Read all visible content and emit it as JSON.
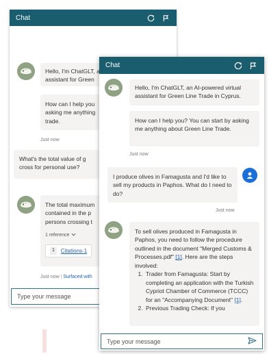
{
  "back_panel": {
    "title": "Chat",
    "greeting_line1": "Hello, I'm ChatGLT, an AI-powered virtual",
    "greeting_line2": "assistant for Green",
    "help_line1": "How can I help you",
    "help_line2": "asking me anything",
    "help_line3": "trade.",
    "time1": "Just now",
    "question_line1": "What's the total value of g",
    "question_line2": "cross for personal use?",
    "answer_line1": "The total maximum",
    "answer_line2": "contained in the p",
    "answer_line3": "persons crossing t",
    "reference_label": "1 reference",
    "citation_num": "1",
    "citation_label": "Citations-1",
    "time2": "Just now",
    "surfaced_label": "Surfaced with",
    "input_placeholder": "Type your message"
  },
  "front_panel": {
    "title": "Chat",
    "greeting": "Hello, I'm ChatGLT, an AI-powered virtual assistant for Green Line Trade in Cyprus.",
    "help": "How can I help you? You can start by asking me anything about Green Line Trade.",
    "time1": "Just now",
    "user_message": "I produce olives in Famagusta and I'd like to sell my products in Paphos. What do I need to do?",
    "time2": "Just now",
    "answer_intro_a": "To sell olives produced in Famagusta in Paphos, you need to follow the procedure outlined in the document \"Merged Customs & Processes.pdf\" ",
    "answer_ref1": "[1]",
    "answer_intro_b": ". Here are the steps involved:",
    "step1_a": "Trader from Famagusta: Start by completing an application with the Turkish Cypriot Chamber of Commerce (TCCC) for an \"Accompanying Document\" ",
    "step1_ref": "[1]",
    "step1_b": ".",
    "step2": "Previous Trading Check: If you",
    "input_placeholder": "Type your message"
  },
  "colors": {
    "titlebar": "#1a5d6f",
    "bubble": "#f4f3f1",
    "user_avatar": "#1b6fd6",
    "input_border": "#2f6f86",
    "link": "#1f5fa8"
  },
  "icons": {
    "refresh": "refresh-icon",
    "flag": "flag-icon",
    "bot_avatar": "olive-avatar-icon",
    "user_avatar": "user-icon",
    "send": "send-icon",
    "chevron": "chevron-down-icon"
  }
}
